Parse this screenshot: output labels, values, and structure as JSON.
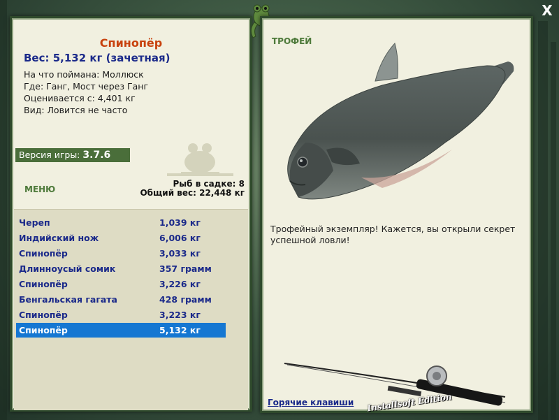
{
  "fish": {
    "name": "Спинопёр",
    "weight_line": "Вес: 5,132 кг (зачетная)",
    "caught_on": "На что поймана: Моллюск",
    "where": "Где: Ганг, Мост через Ганг",
    "valued_from": "Оценивается с: 4,401 кг",
    "kind": "Вид: Ловится не часто"
  },
  "version": {
    "label": "Версия игры:",
    "value": "3.7.6"
  },
  "menu": {
    "label": "МЕНЮ"
  },
  "cage": {
    "fish_count": "Рыб в садке: 8",
    "total_weight": "Общий вес: 22,448 кг"
  },
  "catch_list": [
    {
      "name": "Череп",
      "weight": "1,039 кг",
      "selected": false
    },
    {
      "name": "Индийский нож",
      "weight": "6,006 кг",
      "selected": false
    },
    {
      "name": "Спинопёр",
      "weight": "3,033 кг",
      "selected": false
    },
    {
      "name": "Длинноусый сомик",
      "weight": "357 грамм",
      "selected": false
    },
    {
      "name": "Спинопёр",
      "weight": "3,226 кг",
      "selected": false
    },
    {
      "name": "Бенгальская гагата",
      "weight": "428 грамм",
      "selected": false
    },
    {
      "name": "Спинопёр",
      "weight": "3,223 кг",
      "selected": false
    },
    {
      "name": "Спинопёр",
      "weight": "5,132 кг",
      "selected": true
    }
  ],
  "trophy": {
    "label": "ТРОФЕЙ",
    "message": "Трофейный экземпляр! Кажется, вы открыли секрет успешной ловли!"
  },
  "footer": {
    "hotkeys": "Горячие клавиши",
    "edition": "Installsoft Edition"
  },
  "window": {
    "close_label": "X"
  },
  "colors": {
    "accent_green": "#4a6e3a",
    "selection_blue": "#1577d2",
    "fish_name": "#c8420e",
    "link_blue": "#1b2a8a"
  },
  "icons": {
    "close": "close-icon",
    "frog": "frog-icon",
    "fish": "fish-illustration",
    "rod": "fishing-rod-illustration"
  }
}
